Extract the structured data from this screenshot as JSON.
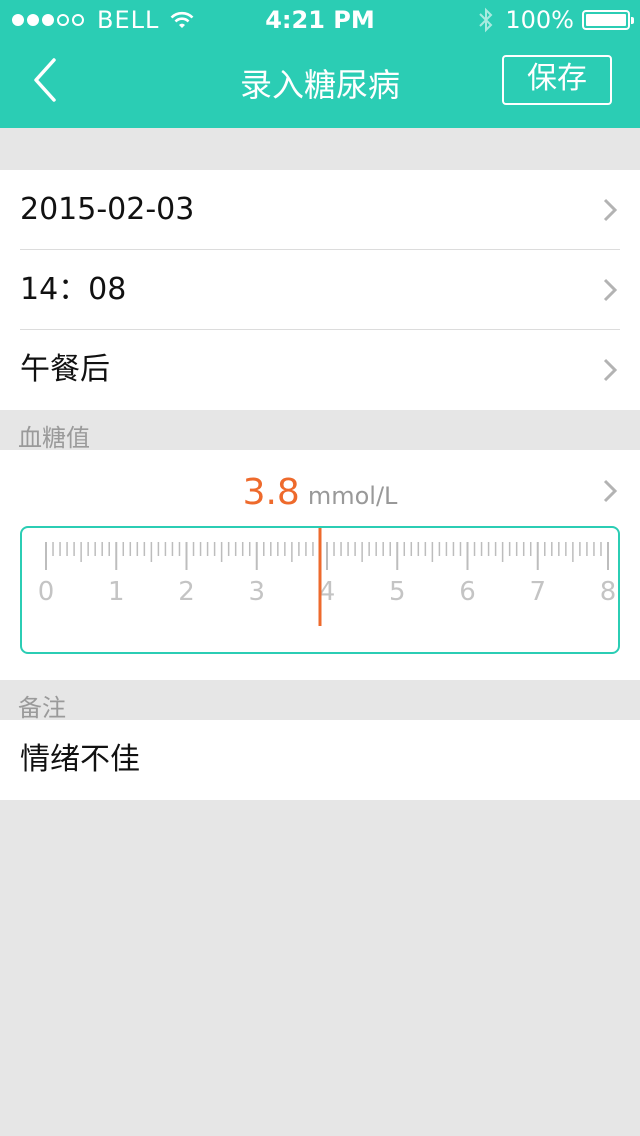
{
  "status_bar": {
    "carrier": "BELL",
    "time": "4:21 PM",
    "battery": "100%",
    "signal_bars": 3,
    "signal_total": 5
  },
  "nav": {
    "title": "录入糖尿病",
    "save_label": "保存"
  },
  "form": {
    "date": "2015-02-03",
    "time": "14：08",
    "meal": "午餐后"
  },
  "blood_sugar": {
    "section_label": "血糖值",
    "value": "3.8",
    "unit": "mmol/L",
    "ruler_labels": [
      "0",
      "1",
      "2",
      "3",
      "4",
      "5",
      "6",
      "7",
      "8"
    ],
    "ruler_min": 0,
    "ruler_max": 8,
    "indicator_value": 3.8
  },
  "note": {
    "section_label": "备注",
    "text": "情绪不佳"
  },
  "colors": {
    "accent": "#2bcdb4",
    "value_orange": "#ee6a2c",
    "background": "#e6e6e6"
  }
}
